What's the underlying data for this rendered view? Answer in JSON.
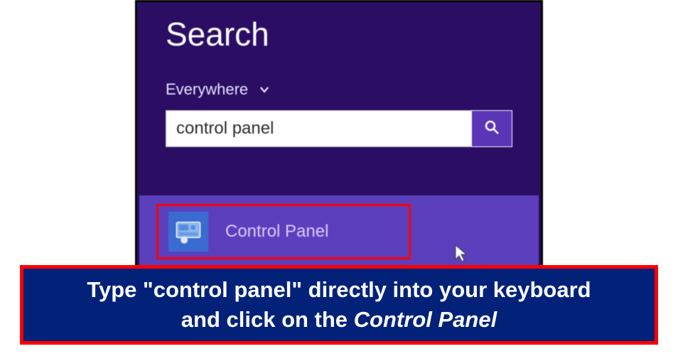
{
  "search": {
    "title": "Search",
    "scope_label": "Everywhere",
    "input_value": "control panel",
    "input_placeholder": ""
  },
  "result": {
    "label": "Control Panel",
    "icon": "control-panel-icon"
  },
  "caption": {
    "line1": "Type \"control panel\" directly into your keyboard",
    "line2_prefix": "and click on the ",
    "line2_italic": "Control Panel"
  }
}
